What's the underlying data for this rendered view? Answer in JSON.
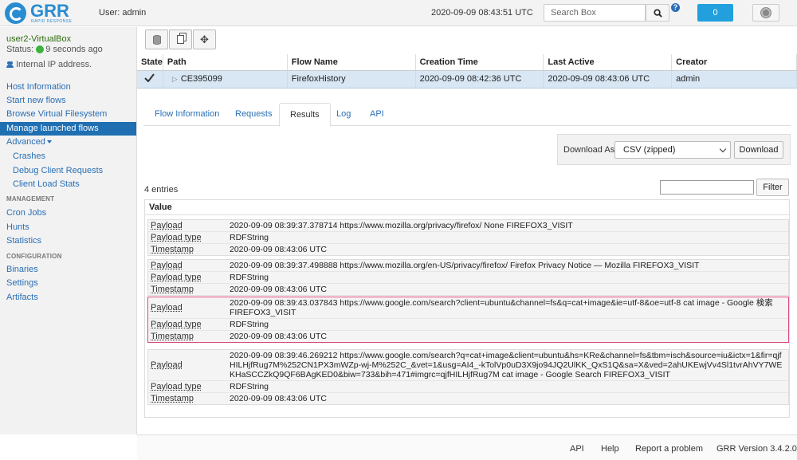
{
  "header": {
    "user_text": "User: admin",
    "clock": "2020-09-09 08:43:51 UTC",
    "search_placeholder": "Search Box",
    "notifications_count": "0",
    "logo_text": "GRR",
    "logo_subtext": "RAPID RESPONSE"
  },
  "sidebar": {
    "client_name": "user2-VirtualBox",
    "status_label": "Status:",
    "status_text": "9 seconds ago",
    "ip_text": "Internal IP address.",
    "items": [
      {
        "label": "Host Information"
      },
      {
        "label": "Start new flows"
      },
      {
        "label": "Browse Virtual Filesystem"
      },
      {
        "label": "Manage launched flows"
      },
      {
        "label": "Advanced"
      },
      {
        "label": "Crashes"
      },
      {
        "label": "Debug Client Requests"
      },
      {
        "label": "Client Load Stats"
      },
      {
        "label": "Cron Jobs"
      },
      {
        "label": "Hunts"
      },
      {
        "label": "Statistics"
      },
      {
        "label": "Binaries"
      },
      {
        "label": "Settings"
      },
      {
        "label": "Artifacts"
      }
    ],
    "section_management": "MANAGEMENT",
    "section_configuration": "CONFIGURATION"
  },
  "flow_table": {
    "headers": [
      "State",
      "Path",
      "Flow Name",
      "Creation Time",
      "Last Active",
      "Creator"
    ],
    "row": {
      "path": "CE395099",
      "flow_name": "FirefoxHistory",
      "creation_time": "2020-09-09 08:42:36 UTC",
      "last_active": "2020-09-09 08:43:06 UTC",
      "creator": "admin"
    }
  },
  "tabs": [
    "Flow Information",
    "Requests",
    "Results",
    "Log",
    "API"
  ],
  "download": {
    "label": "Download As:",
    "selected": "CSV (zipped)",
    "button": "Download"
  },
  "results": {
    "count_text": "4 entries",
    "filter_button": "Filter",
    "column": "Value",
    "key_payload": "Payload",
    "key_payload_type": "Payload type",
    "key_timestamp": "Timestamp",
    "entries": [
      {
        "payload": "2020-09-09 08:39:37.378714 https://www.mozilla.org/privacy/firefox/ None FIREFOX3_VISIT",
        "payload_type": "RDFString",
        "timestamp": "2020-09-09 08:43:06 UTC"
      },
      {
        "payload": "2020-09-09 08:39:37.498888 https://www.mozilla.org/en-US/privacy/firefox/ Firefox Privacy Notice — Mozilla FIREFOX3_VISIT",
        "payload_type": "RDFString",
        "timestamp": "2020-09-09 08:43:06 UTC"
      },
      {
        "payload": "2020-09-09 08:39:43.037843 https://www.google.com/search?client=ubuntu&channel=fs&q=cat+image&ie=utf-8&oe=utf-8 cat image - Google 検索 FIREFOX3_VISIT",
        "payload_type": "RDFString",
        "timestamp": "2020-09-09 08:43:06 UTC"
      },
      {
        "payload": "2020-09-09 08:39:46.269212 https://www.google.com/search?q=cat+image&client=ubuntu&hs=KRe&channel=fs&tbm=isch&source=iu&ictx=1&fir=qjfHILHjfRug7M%252CN1PX3mWZp-wj-M%252C_&vet=1&usg=AI4_-kTolVp0uD3X9jo94JQ2UlKK_QxS1Q&sa=X&ved=2ahUKEwjVv4Sl1tvrAhVY7WEKHaSCCZkQ9QF6BAgKED0&biw=733&bih=471#imgrc=qjfHILHjfRug7M cat image - Google Search FIREFOX3_VISIT",
        "payload_type": "RDFString",
        "timestamp": "2020-09-09 08:43:06 UTC"
      }
    ]
  },
  "footer": {
    "links": [
      "API",
      "Help",
      "Report a problem",
      "GRR Version 3.4.2.0"
    ]
  },
  "colors": {
    "accent": "#1f6fb2",
    "link": "#2a6fb5",
    "highlight_border": "#d9497c",
    "selected_row": "#d8e7f3"
  }
}
